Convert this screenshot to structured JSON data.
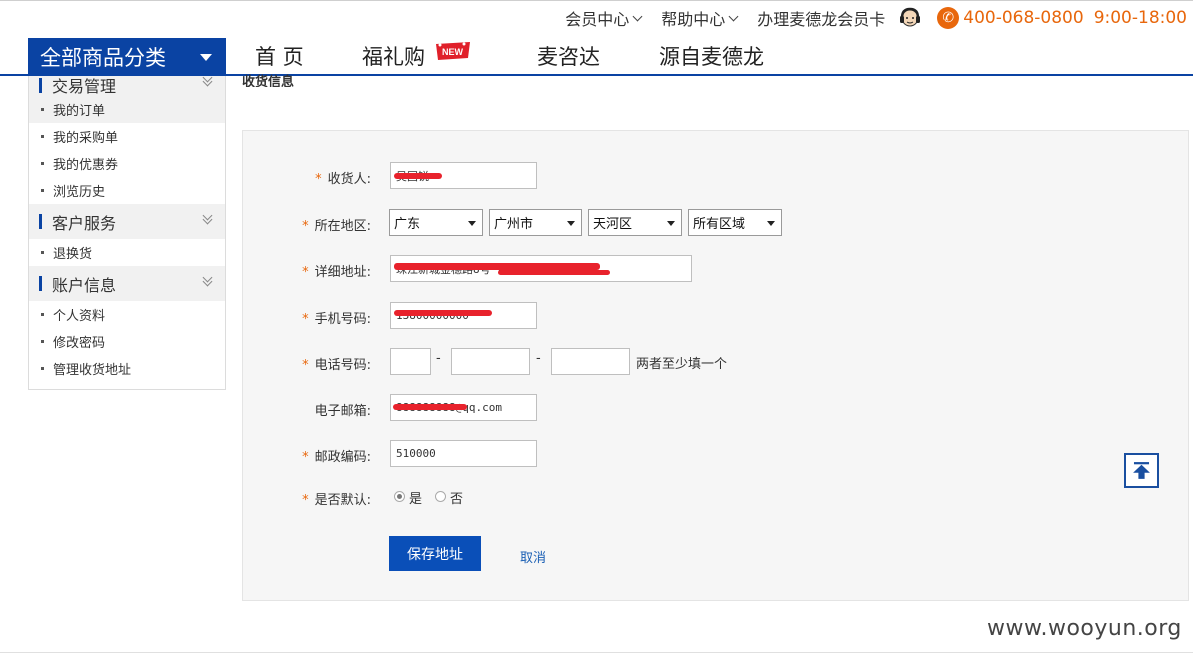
{
  "topbar": {
    "member_center": "会员中心",
    "help_center": "帮助中心",
    "member_card": "办理麦德龙会员卡",
    "phone": "400-068-0800",
    "hours": "9:00-18:00",
    "accent_color": "#e8670c"
  },
  "nav": {
    "all_categories": "全部商品分类",
    "items": [
      "首 页",
      "福礼购",
      "麦咨达",
      "源自麦德龙"
    ],
    "new_badge": "NEW",
    "brand_color": "#0a43a3"
  },
  "sidebar": {
    "groups": [
      {
        "title": "交易管理",
        "items": [
          "我的订单",
          "我的采购单",
          "我的优惠券",
          "浏览历史"
        ]
      },
      {
        "title": "客户服务",
        "items": [
          "退换货"
        ]
      },
      {
        "title": "账户信息",
        "items": [
          "个人资料",
          "修改密码",
          "管理收货地址"
        ]
      }
    ]
  },
  "section_title": "收货信息",
  "form": {
    "recipient": {
      "label": "收货人:",
      "value": "吴国锐"
    },
    "region": {
      "label": "所在地区:",
      "province": "广东",
      "city": "广州市",
      "district": "天河区",
      "area": "所有区域"
    },
    "address": {
      "label": "详细地址:",
      "value": "珠江新城金穗路8号 富力盈凯大厦"
    },
    "mobile": {
      "label": "手机号码:",
      "value": "13800000000"
    },
    "telephone": {
      "label": "电话号码:",
      "separator": "-",
      "hint": "两者至少填一个"
    },
    "email": {
      "label": "电子邮箱:",
      "value": "888888888@qq.com"
    },
    "postcode": {
      "label": "邮政编码:",
      "value": "510000"
    },
    "default": {
      "label": "是否默认:",
      "yes": "是",
      "no": "否",
      "selected": "yes"
    },
    "save_label": "保存地址",
    "cancel_label": "取消"
  },
  "watermark": "www.wooyun.org"
}
